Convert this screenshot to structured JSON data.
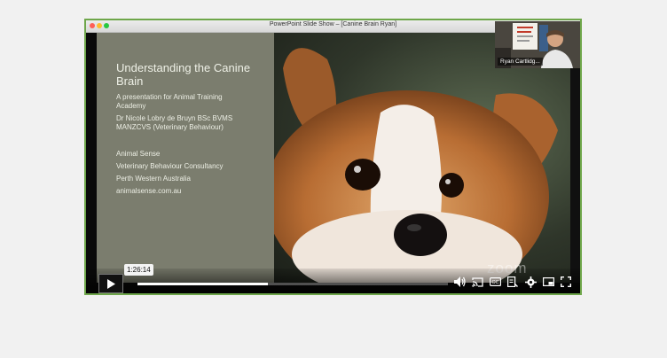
{
  "window": {
    "title": "PowerPoint Slide Show – [Canine Brain Ryan]"
  },
  "slide": {
    "title_line1": "Understanding the Canine",
    "title_line2": "Brain",
    "subtitle_line1": "A presentation for Animal Training",
    "subtitle_line2": "Academy",
    "author_line1": "Dr Nicole Lobry de Bruyn BSc BVMS",
    "author_line2": "MANZCVS (Veterinary Behaviour)",
    "org_line1": "Animal Sense",
    "org_line2": "Veterinary Behaviour Consultancy",
    "org_line3": "Perth Western Australia",
    "org_line4": "animalsense.com.au"
  },
  "webcam": {
    "name": "Ryan Cartlidg..."
  },
  "watermark": {
    "text": "zoom"
  },
  "player": {
    "hover_time": "1:26:14",
    "progress_fraction": 0.42
  },
  "icons": {
    "play": "play-icon",
    "volume": "volume-icon",
    "cast": "cast-icon",
    "captions": "captions-icon",
    "transcript": "transcript-icon",
    "settings": "gear-icon",
    "miniplayer": "miniplayer-icon",
    "fullscreen": "fullscreen-icon"
  },
  "colors": {
    "frame_border": "#6ea64a",
    "slide_panel": "#7b7d6e"
  }
}
